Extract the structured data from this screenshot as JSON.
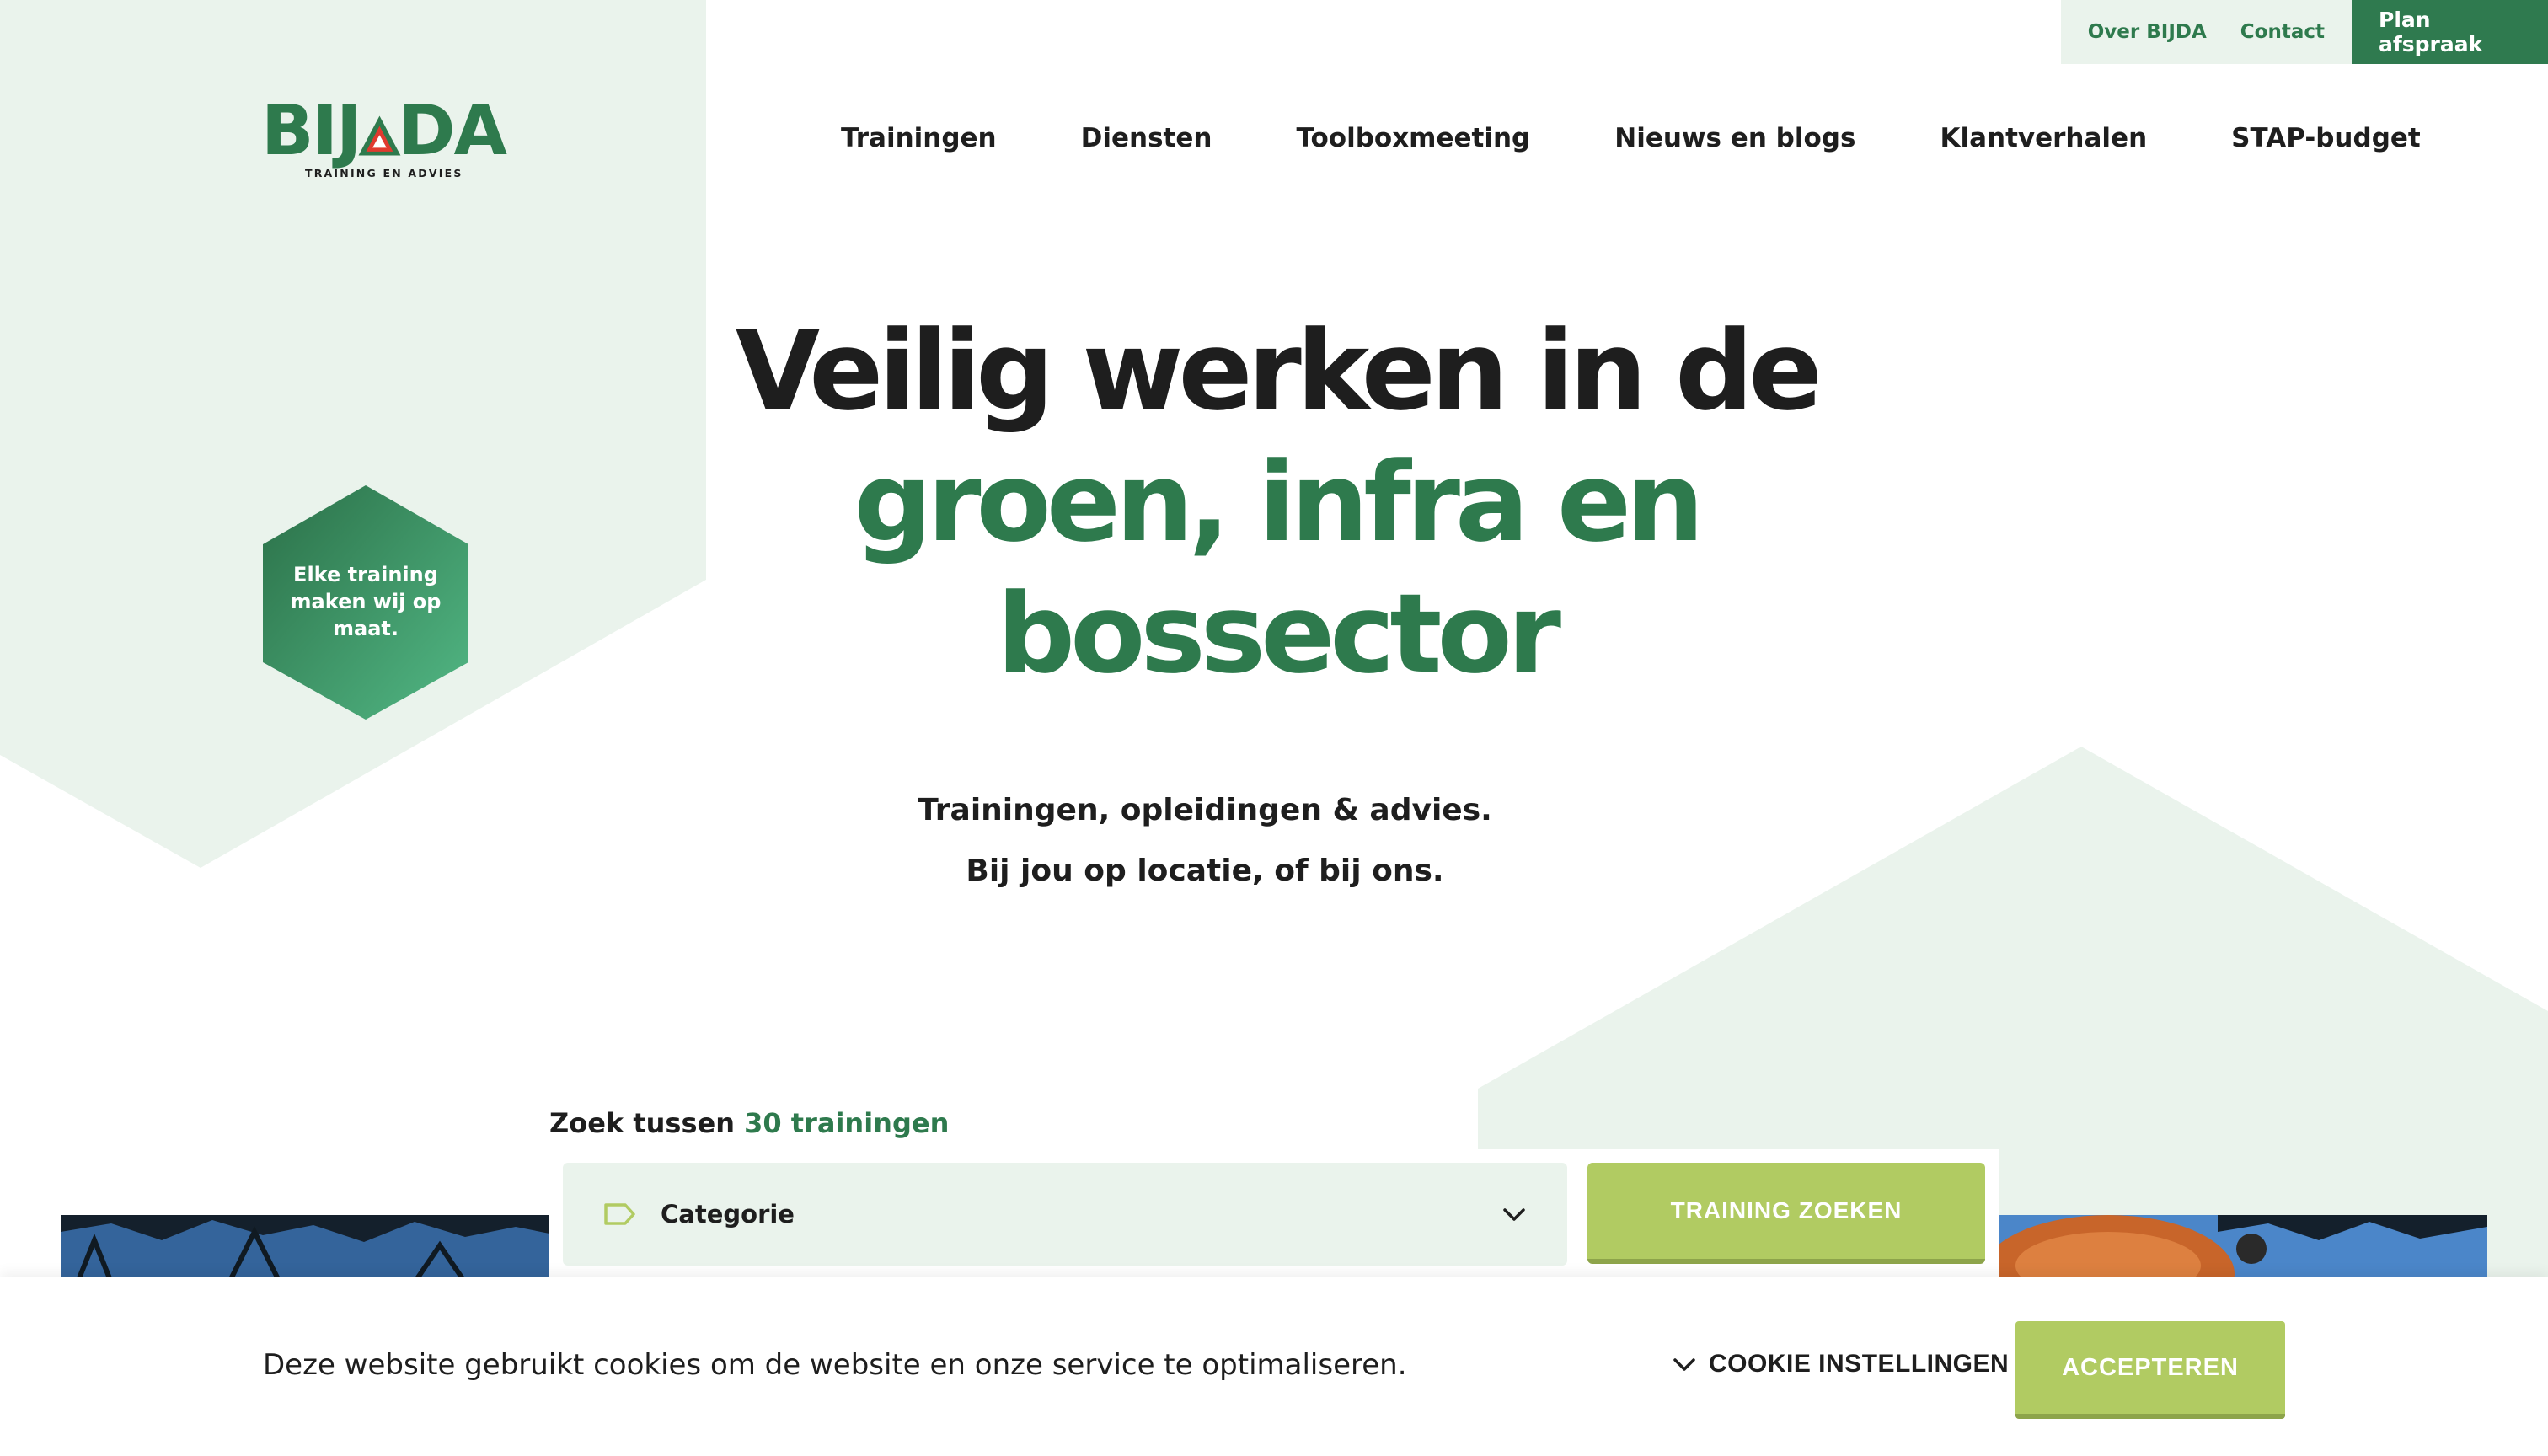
{
  "topbar": {
    "about": "Over BIJDA",
    "contact": "Contact",
    "cta": "Plan afspraak"
  },
  "logo": {
    "word_left": "BIJ",
    "word_right": "DA",
    "tagline": "TRAINING EN ADVIES"
  },
  "nav": [
    {
      "label": "Trainingen"
    },
    {
      "label": "Diensten"
    },
    {
      "label": "Toolboxmeeting"
    },
    {
      "label": "Nieuws en blogs"
    },
    {
      "label": "Klantverhalen"
    },
    {
      "label": "STAP-budget"
    }
  ],
  "badge": {
    "text": "Elke training maken wij op maat."
  },
  "hero": {
    "line1": "Veilig werken in de",
    "line2": "groen, infra en",
    "line3": "bossector",
    "sub1": "Trainingen, opleidingen & advies.",
    "sub2": "Bij jou op locatie, of bij ons."
  },
  "search": {
    "prefix": "Zoek tussen",
    "count": "30 trainingen",
    "select_label": "Categorie",
    "button": "TRAINING ZOEKEN",
    "icons": {
      "tag": "tag-icon",
      "chevron": "chevron-down-icon"
    }
  },
  "cookie": {
    "message": "Deze website gebruikt cookies om de website en onze service te optimaliseren.",
    "settings": "COOKIE INSTELLINGEN",
    "accept": "ACCEPTEREN"
  },
  "colors": {
    "brand_green": "#2e7a4d",
    "light_green_bg": "#eaf3ec",
    "lime_button": "#b1cb62",
    "text_dark": "#1e1e1e",
    "logo_red": "#e03a2f"
  }
}
